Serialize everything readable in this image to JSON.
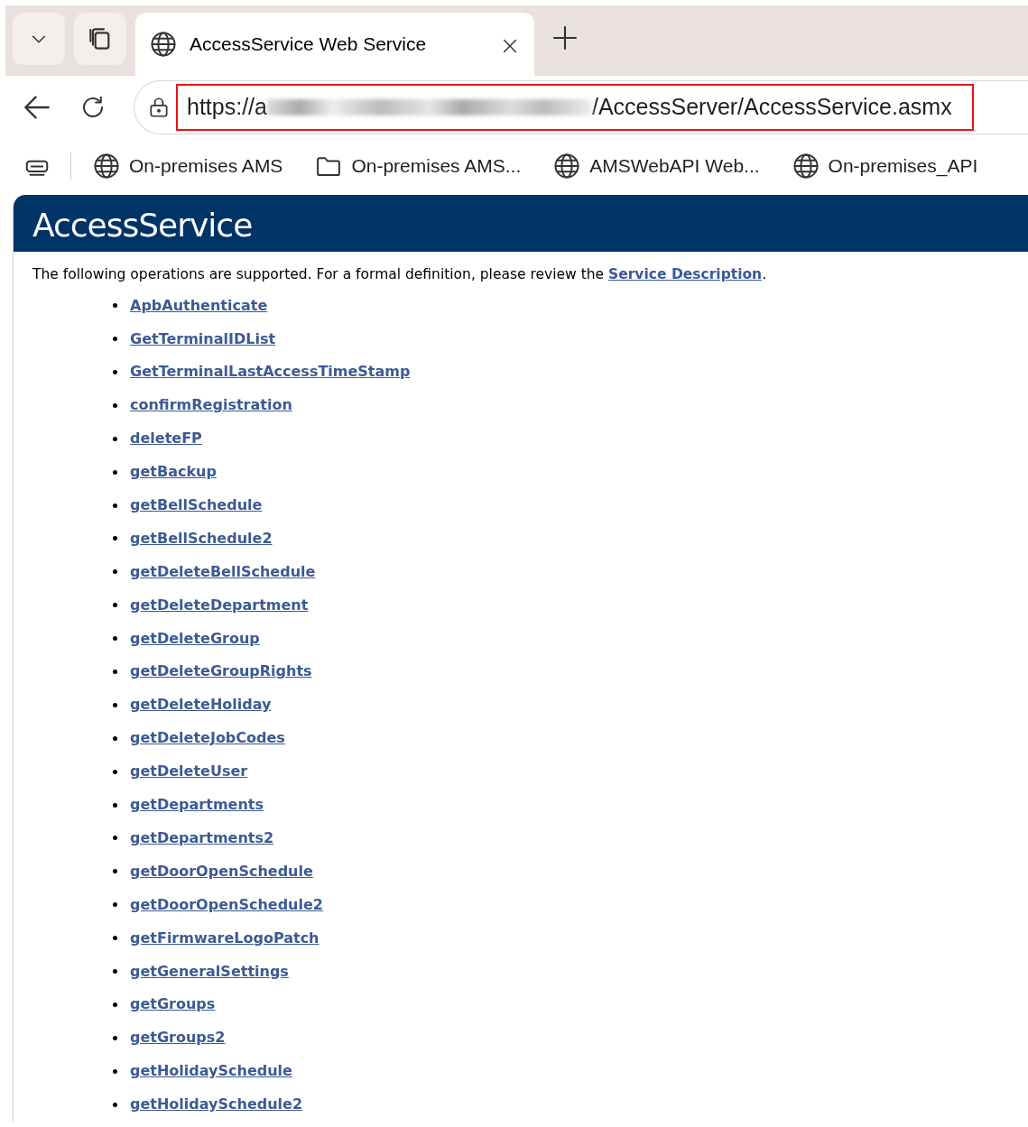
{
  "browser": {
    "tab": {
      "title": "AccessService Web Service",
      "selected": true
    },
    "address": {
      "prefix": "https://a",
      "suffix": "/AccessServer/AccessService.asmx",
      "highlighted": true
    },
    "bookmarks": [
      {
        "kind": "site",
        "label": "On-premises AMS"
      },
      {
        "kind": "folder",
        "label": "On-premises AMS..."
      },
      {
        "kind": "site",
        "label": "AMSWebAPI Web..."
      },
      {
        "kind": "site",
        "label": "On-premises_API"
      }
    ]
  },
  "page": {
    "heading": "AccessService",
    "intro": "The following operations are supported. For a formal definition, please review the ",
    "intro_link": "Service Description",
    "intro_end": ".",
    "operations": [
      "ApbAuthenticate",
      "GetTerminalIDList",
      "GetTerminalLastAccessTimeStamp",
      "confirmRegistration",
      "deleteFP",
      "getBackup",
      "getBellSchedule",
      "getBellSchedule2",
      "getDeleteBellSchedule",
      "getDeleteDepartment",
      "getDeleteGroup",
      "getDeleteGroupRights",
      "getDeleteHoliday",
      "getDeleteJobCodes",
      "getDeleteUser",
      "getDepartments",
      "getDepartments2",
      "getDoorOpenSchedule",
      "getDoorOpenSchedule2",
      "getFirmwareLogoPatch",
      "getGeneralSettings",
      "getGroups",
      "getGroups2",
      "getHolidaySchedule",
      "getHolidaySchedule2"
    ]
  }
}
